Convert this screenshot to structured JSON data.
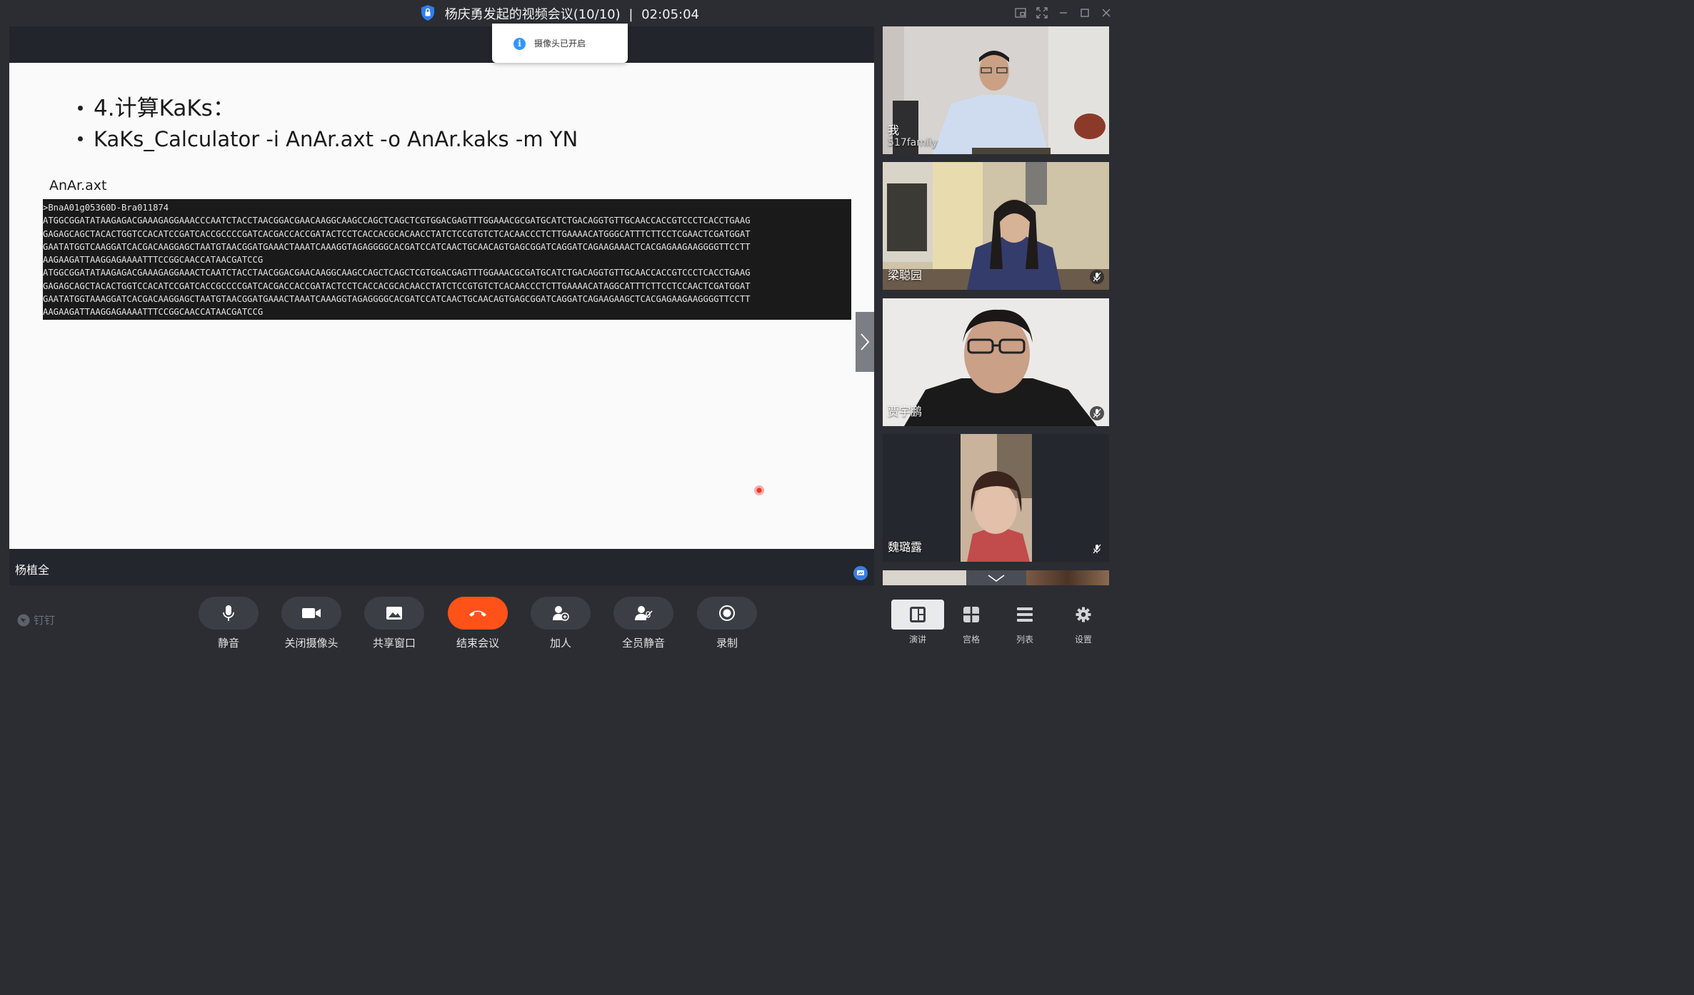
{
  "window": {
    "title": "杨庆勇发起的视频会议(10/10)",
    "separator": "|",
    "elapsed": "02:05:04"
  },
  "toast": {
    "message": "摄像头已开启",
    "icon": "info-icon"
  },
  "slide": {
    "bullet1": "4.计算KaKs：",
    "bullet2": "KaKs_Calculator -i AnAr.axt -o AnAr.kaks -m YN",
    "file_label": "AnAr.axt",
    "terminal_lines": [
      ">BnaA01g05360D-Bra011874",
      "ATGGCGGATATAAGAGACGAAAGAGGAAACCCAATCTACCTAACGGACGAACAAGGCAAGCCAGCTCAGCTCGTGGACGAGTTTGGAAACGCGATGCATCTGACAGGTGTTGCAACCACCGTCCCTCACCTGAAG",
      "GAGAGCAGCTACACTGGTCCACATCCGATCACCGCCCCGATCACGACCACCGATACTCCTCACCACGCACAACCTATCTCCGTGTCTCACAACCCTCTTGAAAACATGGGCATTTCTTCCTCGAACTCGATGGAT",
      "GAATATGGTCAAGGATCACGACAAGGAGCTAATGTAACGGATGAAACTAAATCAAAGGTAGAGGGGCACGATCCATCAACTGCAACAGTGAGCGGATCAGGATCAGAAGAAACTCACGAGAAGAAGGGGTTCCTT",
      "AAGAAGATTAAGGAGAAAATTTCCGGCAACCATAACGATCCG",
      "ATGGCGGATATAAGAGACGAAAGAGGAAACTCAATCTACCTAACGGACGAACAAGGCAAGCCAGCTCAGCTCGTGGACGAGTTTGGAAACGCGATGCATCTGACAGGTGTTGCAACCACCGTCCCTCACCTGAAG",
      "GAGAGCAGCTACACTGGTCCACATCCGATCACCGCCCCGATCACGACCACCGATACTCCTCACCACGCACAACCTATCTCCGTGTCTCACAACCCTCTTGAAAACATAGGCATTTCTTCCTCCAACTCGATGGAT",
      "GAATATGGTAAAGGATCACGACAAGGAGCTAATGTAACGGATGAAACTAAATCAAAGGTAGAGGGGCACGATCCATCAACTGCAACAGTGAGCGGATCAGGATCAGAAGAAGCTCACGAGAAGAAGGGGTTCCTT",
      "AAGAAGATTAAGGAGAAAATTTCCGGCAACCATAACGATCCG"
    ]
  },
  "main_speaker": {
    "name": "杨植全"
  },
  "participants": [
    {
      "name": "我",
      "subtitle": "517famliy",
      "muted": false
    },
    {
      "name": "梁聪园",
      "subtitle": "",
      "muted": true
    },
    {
      "name": "贾宇鹏",
      "subtitle": "",
      "muted": true
    },
    {
      "name": "魏璐露",
      "subtitle": "",
      "muted": true
    }
  ],
  "brand": "钉钉",
  "controls": [
    {
      "label": "静音",
      "icon": "microphone-icon"
    },
    {
      "label": "关闭摄像头",
      "icon": "camera-icon"
    },
    {
      "label": "共享窗口",
      "icon": "share-window-icon"
    },
    {
      "label": "结束会议",
      "icon": "hang-up-icon"
    },
    {
      "label": "加人",
      "icon": "add-person-icon"
    },
    {
      "label": "全员静音",
      "icon": "mute-all-icon"
    },
    {
      "label": "录制",
      "icon": "record-icon"
    }
  ],
  "views": [
    {
      "label": "演讲",
      "icon": "speaker-layout-icon",
      "active": true
    },
    {
      "label": "宫格",
      "icon": "grid-layout-icon",
      "active": false
    },
    {
      "label": "列表",
      "icon": "list-layout-icon",
      "active": false
    },
    {
      "label": "设置",
      "icon": "gear-icon",
      "active": false
    }
  ],
  "colors": {
    "end_button": "#ff5219",
    "info_blue": "#3296fa",
    "shield_blue": "#2f7ff0",
    "background": "#2b2d33"
  }
}
